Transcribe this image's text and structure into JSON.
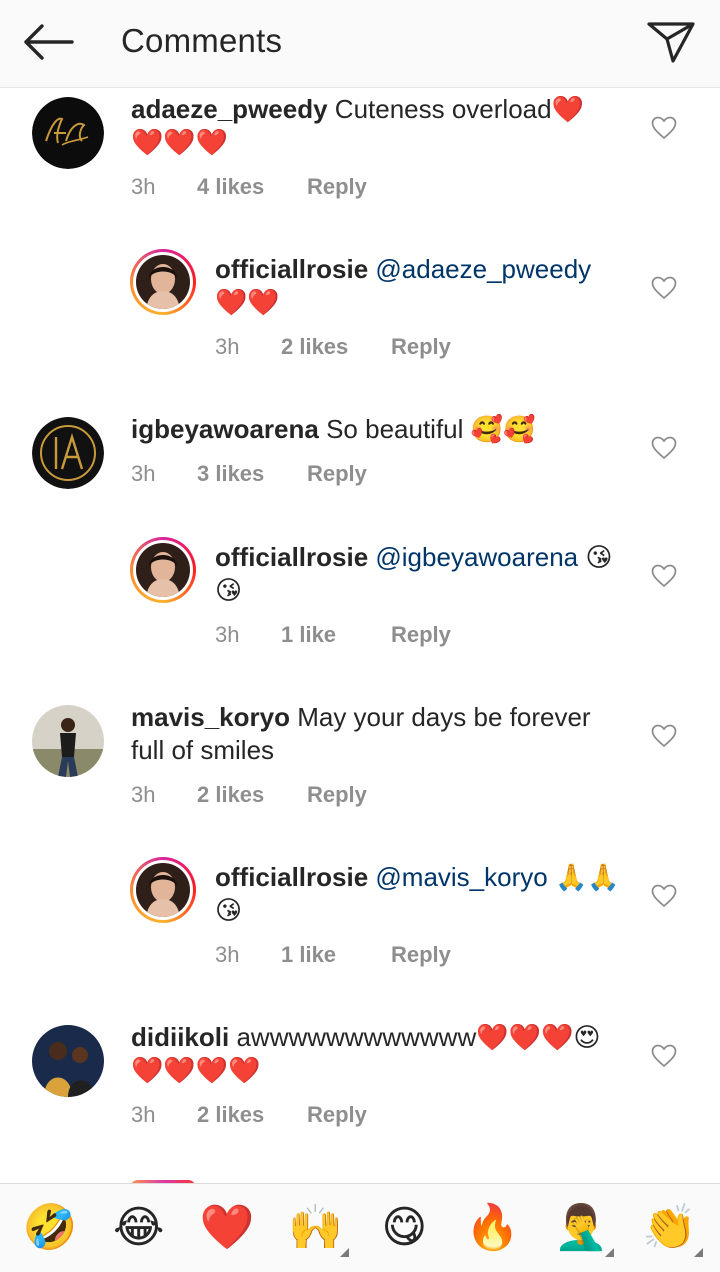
{
  "header": {
    "title": "Comments"
  },
  "comments": [
    {
      "username": "adaeze_pweedy",
      "mention": "",
      "text": " Cuteness overload❤️❤️❤️❤️",
      "time": "3h",
      "likes": "4 likes",
      "reply": "Reply",
      "avatar": "adaeze-logo"
    },
    {
      "username": "officiallrosie",
      "mention": "@adaeze_pweedy",
      "text": " ❤️❤️",
      "time": "3h",
      "likes": "2 likes",
      "reply": "Reply",
      "avatar": "rosie-photo"
    },
    {
      "username": "igbeyawoarena",
      "mention": "",
      "text": " So beautiful 🥰🥰",
      "time": "3h",
      "likes": "3 likes",
      "reply": "Reply",
      "avatar": "ia-logo"
    },
    {
      "username": "officiallrosie",
      "mention": "@igbeyawoarena",
      "text": " 😘😘",
      "time": "3h",
      "likes": "1 like",
      "reply": "Reply",
      "avatar": "rosie-photo"
    },
    {
      "username": "mavis_koryo",
      "mention": "",
      "text": " May your days be forever full of smiles",
      "time": "3h",
      "likes": "2 likes",
      "reply": "Reply",
      "avatar": "mavis-photo"
    },
    {
      "username": "officiallrosie",
      "mention": "@mavis_koryo",
      "text": " 🙏🙏😘",
      "time": "3h",
      "likes": "1 like",
      "reply": "Reply",
      "avatar": "rosie-photo"
    },
    {
      "username": "didiikoli",
      "mention": "",
      "text": " awwwwwwwwwwww❤️❤️❤️😍❤️❤️❤️❤️",
      "time": "3h",
      "likes": "2 likes",
      "reply": "Reply",
      "avatar": "didi-photo"
    }
  ],
  "emoji_bar": [
    {
      "glyph": "🤣",
      "name": "rofl-emoji",
      "more": false
    },
    {
      "glyph": "😂",
      "name": "tears-of-joy-emoji",
      "more": false
    },
    {
      "glyph": "❤️",
      "name": "heart-emoji",
      "more": false
    },
    {
      "glyph": "🙌",
      "name": "raised-hands-emoji",
      "more": true
    },
    {
      "glyph": "😋",
      "name": "yum-emoji",
      "more": false
    },
    {
      "glyph": "🔥",
      "name": "fire-emoji",
      "more": false
    },
    {
      "glyph": "🤦‍♂️",
      "name": "facepalm-emoji",
      "more": true
    },
    {
      "glyph": "👏",
      "name": "clap-emoji",
      "more": true
    }
  ],
  "colors": {
    "mention": "#003569",
    "meta": "#8e8e8e",
    "header_bg": "#fafafa"
  }
}
